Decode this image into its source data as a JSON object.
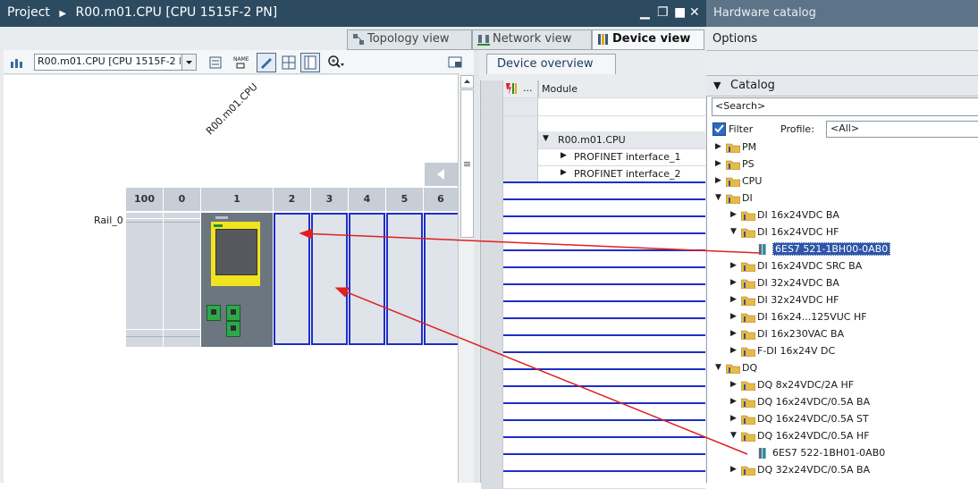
{
  "window": {
    "breadcrumb": [
      "Project",
      "R00.m01.CPU [CPU 1515F-2 PN]"
    ],
    "panel_title": "Hardware catalog"
  },
  "view_tabs": [
    {
      "label": "Topology view",
      "icon": "topology-icon"
    },
    {
      "label": "Network view",
      "icon": "network-icon"
    },
    {
      "label": "Device view",
      "icon": "device-icon",
      "active": true
    }
  ],
  "toolbar": {
    "device_select": "R00.m01.CPU [CPU 1515F-2 PN]"
  },
  "canvas": {
    "device_label": "R00.m01.CPU",
    "rail_label": "Rail_0",
    "slots": [
      "100",
      "0",
      "1",
      "2",
      "3",
      "4",
      "5",
      "6"
    ]
  },
  "overview": {
    "tab_label": "Device overview",
    "col_dots": "...",
    "col_module": "Module",
    "rows": [
      {
        "name": "R00.m01.CPU",
        "expanded": true
      },
      {
        "name": "PROFINET interface_1",
        "expanded": false
      },
      {
        "name": "PROFINET interface_2",
        "expanded": false
      }
    ]
  },
  "catalog": {
    "options_label": "Options",
    "section_label": "Catalog",
    "search_placeholder": "<Search>",
    "filter_label": "Filter",
    "filter_checked": true,
    "profile_label": "Profile:",
    "profile_value": "<All>",
    "tree": [
      {
        "label": "PM",
        "level": 0,
        "expanded": false,
        "type": "folder"
      },
      {
        "label": "PS",
        "level": 0,
        "expanded": false,
        "type": "folder"
      },
      {
        "label": "CPU",
        "level": 0,
        "expanded": false,
        "type": "folder"
      },
      {
        "label": "DI",
        "level": 0,
        "expanded": true,
        "type": "folder"
      },
      {
        "label": "DI 16x24VDC BA",
        "level": 1,
        "expanded": false,
        "type": "folder"
      },
      {
        "label": "DI 16x24VDC HF",
        "level": 1,
        "expanded": true,
        "type": "folder"
      },
      {
        "label": "6ES7 521-1BH00-0AB0",
        "level": 2,
        "type": "module",
        "selected": true
      },
      {
        "label": "DI 16x24VDC SRC BA",
        "level": 1,
        "expanded": false,
        "type": "folder"
      },
      {
        "label": "DI 32x24VDC BA",
        "level": 1,
        "expanded": false,
        "type": "folder"
      },
      {
        "label": "DI 32x24VDC HF",
        "level": 1,
        "expanded": false,
        "type": "folder"
      },
      {
        "label": "DI 16x24...125VUC HF",
        "level": 1,
        "expanded": false,
        "type": "folder"
      },
      {
        "label": "DI 16x230VAC BA",
        "level": 1,
        "expanded": false,
        "type": "folder"
      },
      {
        "label": "F-DI 16x24V DC",
        "level": 1,
        "expanded": false,
        "type": "folder"
      },
      {
        "label": "DQ",
        "level": 0,
        "expanded": true,
        "type": "folder"
      },
      {
        "label": "DQ 8x24VDC/2A HF",
        "level": 1,
        "expanded": false,
        "type": "folder"
      },
      {
        "label": "DQ 16x24VDC/0.5A BA",
        "level": 1,
        "expanded": false,
        "type": "folder"
      },
      {
        "label": "DQ 16x24VDC/0.5A ST",
        "level": 1,
        "expanded": false,
        "type": "folder"
      },
      {
        "label": "DQ 16x24VDC/0.5A HF",
        "level": 1,
        "expanded": true,
        "type": "folder"
      },
      {
        "label": "6ES7 522-1BH01-0AB0",
        "level": 2,
        "type": "module"
      },
      {
        "label": "DQ 32x24VDC/0.5A BA",
        "level": 1,
        "expanded": false,
        "type": "folder"
      }
    ]
  },
  "colors": {
    "title_bar": "#2c4a60",
    "slot_border": "#1e2ec8",
    "arrow": "#e02020",
    "selection": "#2e55a8",
    "cpu_yellow": "#f1e41e"
  }
}
